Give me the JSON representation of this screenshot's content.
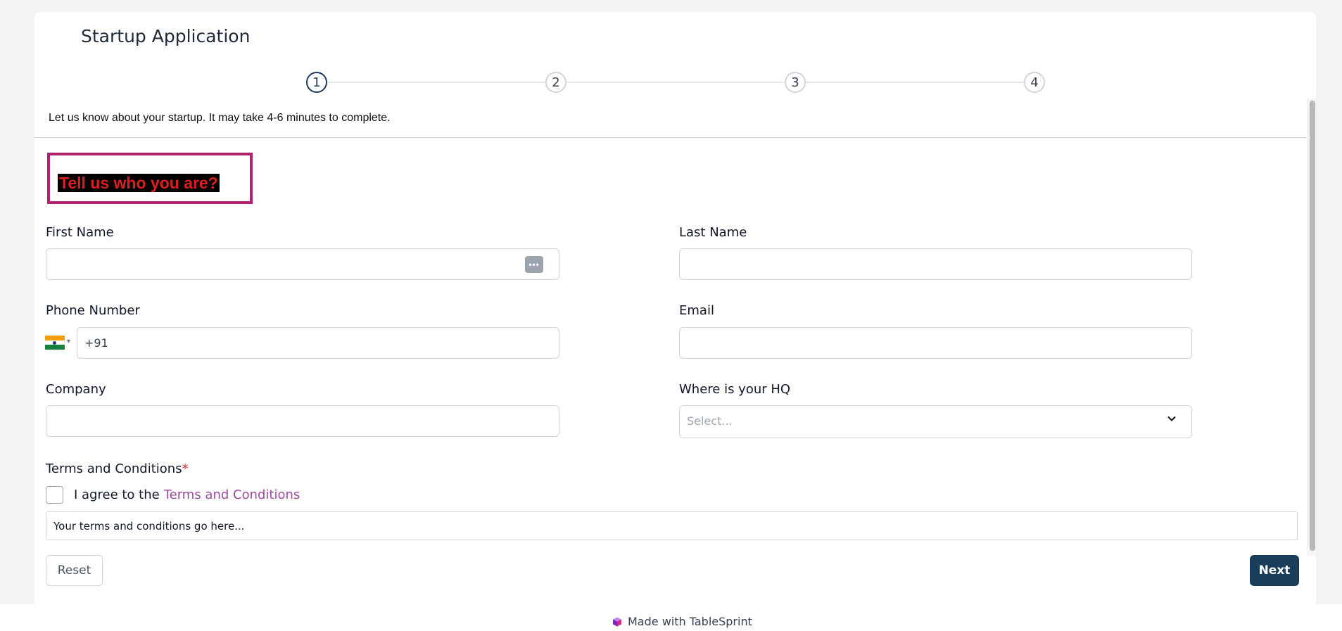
{
  "app": {
    "title": "Startup Application"
  },
  "stepper": {
    "steps": [
      "1",
      "2",
      "3",
      "4"
    ],
    "active_step": 1
  },
  "intro": {
    "subtitle": "Let us know about your startup. It may take 4-6 minutes to complete."
  },
  "section": {
    "heading": "Tell us who you are?"
  },
  "fields": {
    "first_name": {
      "label": "First Name",
      "value": ""
    },
    "last_name": {
      "label": "Last Name",
      "value": ""
    },
    "phone": {
      "label": "Phone Number",
      "value": "+91",
      "country_flag": "india-flag-icon"
    },
    "email": {
      "label": "Email",
      "value": ""
    },
    "company": {
      "label": "Company",
      "value": ""
    },
    "hq": {
      "label": "Where is your HQ",
      "placeholder": "Select..."
    }
  },
  "terms": {
    "label": "Terms and Conditions",
    "required_marker": "*",
    "agree_prefix": "I agree to the",
    "agree_link": "Terms and Conditions",
    "content": "Your terms and conditions go here..."
  },
  "buttons": {
    "reset": "Reset",
    "next": "Next"
  },
  "footer": {
    "text": "Made with TableSprint"
  },
  "colors": {
    "primary": "#1a3d5c",
    "highlight_border": "#b3206f",
    "heading_text": "#e11d1d",
    "link": "#9b4a9b"
  }
}
